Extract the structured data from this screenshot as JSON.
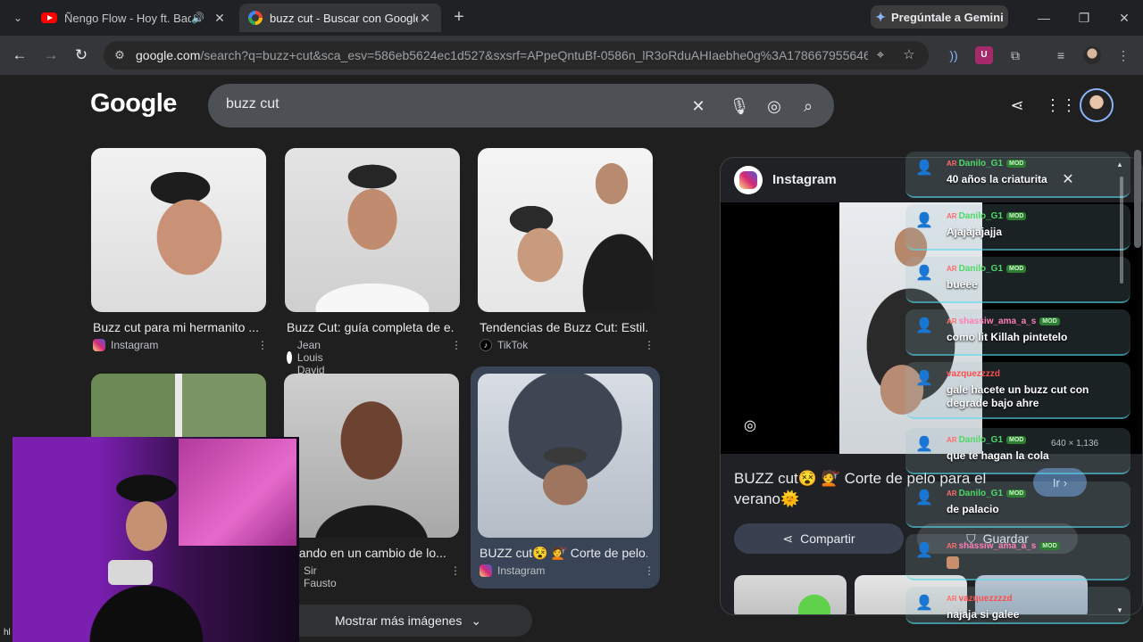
{
  "browser": {
    "tabs": [
      {
        "title": "Ñengo Flow - Hoy ft. Bad B"
      },
      {
        "title": "buzz cut - Buscar con Google"
      }
    ],
    "gemini_label": "Pregúntale a Gemini",
    "url_host": "google.com",
    "url_rest": "/search?q=buzz+cut&sca_esv=586eb5624ec1d527&sxsrf=APpeQntuBf-0586n_lR3oRduAHIaebhe0g%3A1786679556466&..."
  },
  "google": {
    "logo": "Google",
    "query": "buzz cut"
  },
  "results": [
    {
      "caption": "Buzz cut para mi hermanito ...",
      "source": "Instagram",
      "source_icon": "instagram-icon"
    },
    {
      "caption": "Buzz Cut: guía completa de e...",
      "source": "Jean Louis David",
      "source_icon": "jean-louis-david-icon"
    },
    {
      "caption": "Tendencias de Buzz Cut: Estil...",
      "source": "TikTok",
      "source_icon": "tiktok-icon"
    },
    {
      "caption": "",
      "source": "",
      "source_icon": ""
    },
    {
      "caption": "nsando en un cambio de lo...",
      "source": "Sir Fausto",
      "source_icon": "sir-fausto-icon"
    },
    {
      "caption": "BUZZ cut😵 💇 Corte de pelo...",
      "source": "Instagram",
      "source_icon": "instagram-icon"
    }
  ],
  "more_images_label": "Mostrar más imágenes",
  "panel": {
    "site": "Instagram",
    "title": "BUZZ cut😵 💇 Corte de pelo para el verano🌞",
    "dimensions": "640 × 1,136",
    "go_label": "Ir",
    "share_label": "Compartir",
    "save_label": "Guardar"
  },
  "chat": {
    "messages": [
      {
        "country": "AR",
        "user": "Danilo_G1",
        "mod": "MOD",
        "text": "40 años la criaturita",
        "color": "#4cd964"
      },
      {
        "country": "AR",
        "user": "Danilo_G1",
        "mod": "MOD",
        "text": "Ajajajajajja",
        "color": "#4cd964"
      },
      {
        "country": "AR",
        "user": "Danilo_G1",
        "mod": "MOD",
        "text": "bueee",
        "color": "#4cd964"
      },
      {
        "country": "AR",
        "user": "shassiw_ama_a_s",
        "mod": "MOD",
        "text": "como lit Killah pintetelo",
        "color": "#ff7eb6"
      },
      {
        "country": "",
        "user": "vazquezzzzd",
        "mod": "",
        "text": "gale hacete un buzz cut con degrade bajo ahre",
        "color": "#ff4d4d"
      },
      {
        "country": "AR",
        "user": "Danilo_G1",
        "mod": "MOD",
        "text": "que te hagan la cola",
        "color": "#4cd964"
      },
      {
        "country": "AR",
        "user": "Danilo_G1",
        "mod": "MOD",
        "text": "de palacio",
        "color": "#4cd964"
      },
      {
        "country": "AR",
        "user": "shassiw_ama_a_s",
        "mod": "MOD",
        "text": "",
        "color": "#ff7eb6"
      },
      {
        "country": "AR",
        "user": "vazquezzzzd",
        "mod": "",
        "text": "najaja si galee",
        "color": "#ff4d4d"
      }
    ]
  },
  "webcam": {
    "corner_text": "hl"
  }
}
